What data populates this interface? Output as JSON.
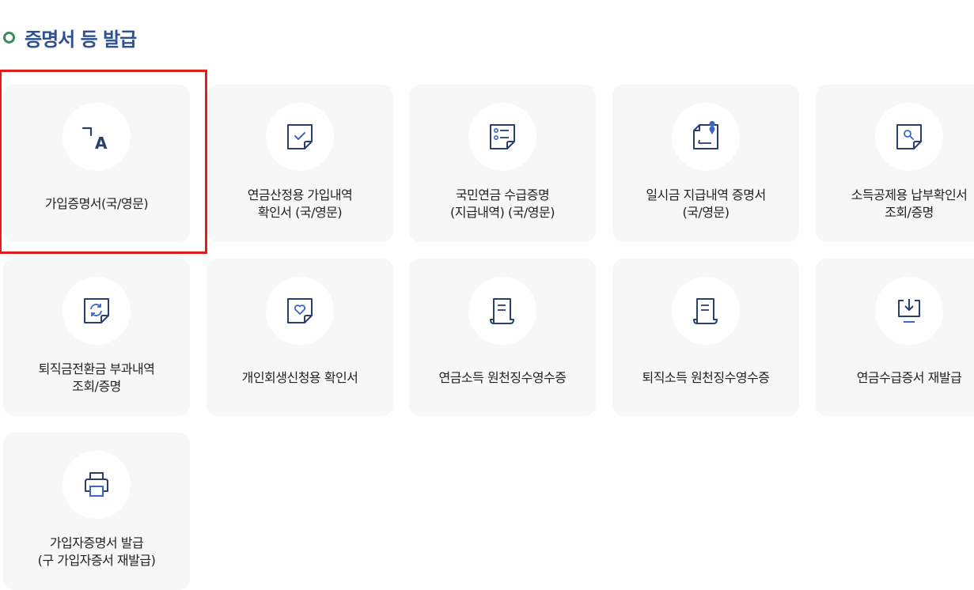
{
  "section": {
    "title": "증명서 등 발급"
  },
  "cards": [
    {
      "line1": "가입증명서(국/영문)",
      "line2": "",
      "icon": "translate-icon"
    },
    {
      "line1": "연금산정용 가입내역",
      "line2": "확인서 (국/영문)",
      "icon": "document-check-icon"
    },
    {
      "line1": "국민연금 수급증명",
      "line2": "(지급내역) (국/영문)",
      "icon": "document-list-icon"
    },
    {
      "line1": "일시금 지급내역 증명서",
      "line2": "(국/영문)",
      "icon": "document-pin-icon"
    },
    {
      "line1": "소득공제용 납부확인서",
      "line2": "조회/증명",
      "icon": "document-search-icon"
    },
    {
      "line1": "퇴직금전환금 부과내역",
      "line2": "조회/증명",
      "icon": "document-refresh-icon"
    },
    {
      "line1": "개인회생신청용 확인서",
      "line2": "",
      "icon": "document-heart-icon"
    },
    {
      "line1": "연금소득 원천징수영수증",
      "line2": "",
      "icon": "receipt-icon"
    },
    {
      "line1": "퇴직소득 원천징수영수증",
      "line2": "",
      "icon": "receipt-icon"
    },
    {
      "line1": "연금수급증서 재발급",
      "line2": "",
      "icon": "download-tray-icon"
    },
    {
      "line1": "가입자증명서 발급",
      "line2": "(구 가입자증서 재발급)",
      "icon": "printer-icon"
    }
  ],
  "colors": {
    "icon_stroke": "#2b3f6e",
    "icon_accent": "#3b66c4",
    "title": "#2f4f8f",
    "title_bullet": "#3d8a5a",
    "highlight_border": "#e21b1b",
    "card_bg": "#f7f7f7"
  }
}
